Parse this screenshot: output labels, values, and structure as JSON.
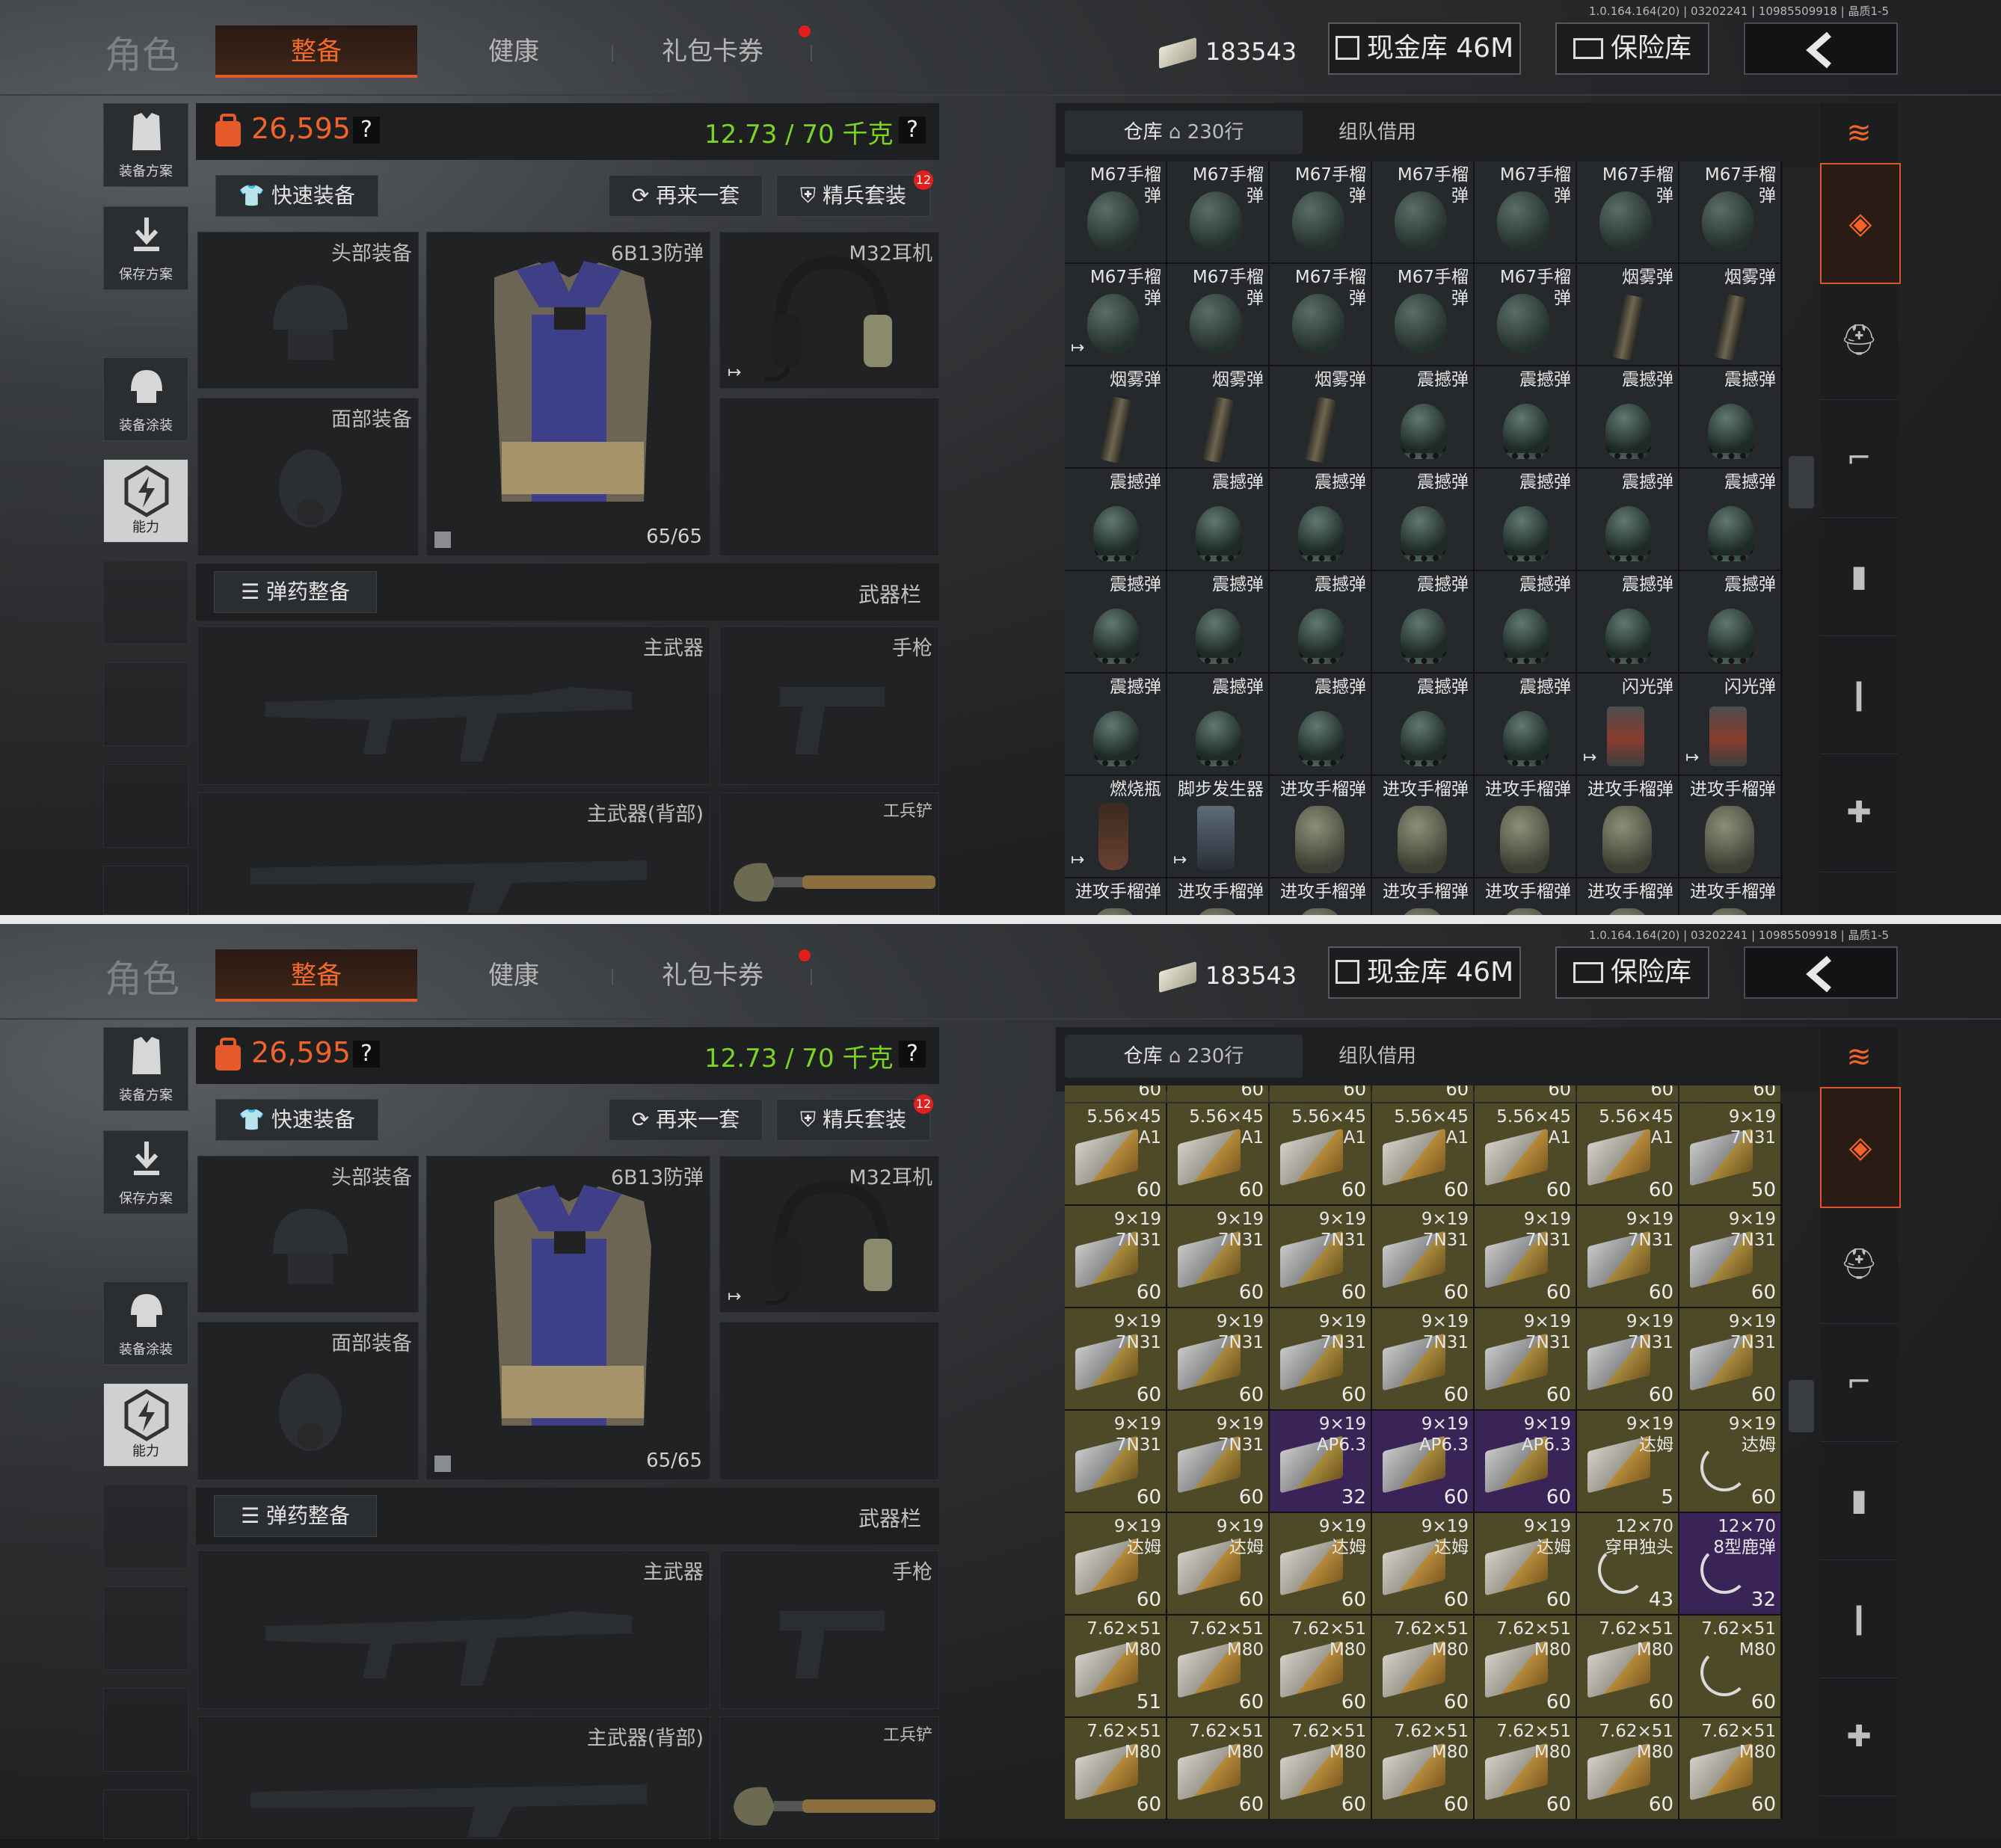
{
  "header": {
    "role_title": "角色",
    "tabs": [
      "整备",
      "健康",
      "礼包卡券"
    ],
    "active_tab": 0,
    "currency_amount": "183543",
    "cash_vault_label": "现金库 46M",
    "safe_label": "保险库",
    "version_text": "1.0.164.164(20) | 03202241 | 10985509918 | 晶质1-5"
  },
  "sidebar": {
    "items": [
      "装备方案",
      "保存方案",
      "装备涂装",
      "能力"
    ]
  },
  "loadout": {
    "value": "26,595",
    "weight": "12.73 / 70 千克",
    "help_icon": "?",
    "quick_equip_label": "快速装备",
    "again_label": "再来一套",
    "elite_label": "精兵套装",
    "elite_badge": "12",
    "head_slot_label": "头部装备",
    "face_slot_label": "面部装备",
    "armor_slot_label": "6B13防弹",
    "armor_durability": "65/65",
    "headset_slot_label": "M32耳机",
    "ammo_setup_label": "弹药整备",
    "weapon_bar_label": "武器栏",
    "primary_label": "主武器",
    "pistol_label": "手枪",
    "primary_back_label": "主武器(背部)",
    "shovel_label": "工兵铲"
  },
  "storage": {
    "tab_warehouse": "仓库",
    "warehouse_rows": "230行",
    "tab_team_borrow": "组队借用"
  },
  "screen1_items": [
    {
      "name": "M67手榴\n弹",
      "icon": "grenade"
    },
    {
      "name": "M67手榴\n弹",
      "icon": "grenade"
    },
    {
      "name": "M67手榴\n弹",
      "icon": "grenade"
    },
    {
      "name": "M67手榴\n弹",
      "icon": "grenade"
    },
    {
      "name": "M67手榴\n弹",
      "icon": "grenade"
    },
    {
      "name": "M67手榴\n弹",
      "icon": "grenade"
    },
    {
      "name": "M67手榴\n弹",
      "icon": "grenade"
    },
    {
      "name": "M67手榴\n弹",
      "icon": "grenade",
      "arrow": true
    },
    {
      "name": "M67手榴\n弹",
      "icon": "grenade"
    },
    {
      "name": "M67手榴\n弹",
      "icon": "grenade"
    },
    {
      "name": "M67手榴\n弹",
      "icon": "grenade"
    },
    {
      "name": "M67手榴\n弹",
      "icon": "grenade"
    },
    {
      "name": "烟雾弹",
      "icon": "smoke"
    },
    {
      "name": "烟雾弹",
      "icon": "smoke"
    },
    {
      "name": "烟雾弹",
      "icon": "smoke"
    },
    {
      "name": "烟雾弹",
      "icon": "smoke"
    },
    {
      "name": "烟雾弹",
      "icon": "smoke"
    },
    {
      "name": "震撼弹",
      "icon": "stun"
    },
    {
      "name": "震撼弹",
      "icon": "stun"
    },
    {
      "name": "震撼弹",
      "icon": "stun"
    },
    {
      "name": "震撼弹",
      "icon": "stun"
    },
    {
      "name": "震撼弹",
      "icon": "stun"
    },
    {
      "name": "震撼弹",
      "icon": "stun"
    },
    {
      "name": "震撼弹",
      "icon": "stun"
    },
    {
      "name": "震撼弹",
      "icon": "stun"
    },
    {
      "name": "震撼弹",
      "icon": "stun"
    },
    {
      "name": "震撼弹",
      "icon": "stun"
    },
    {
      "name": "震撼弹",
      "icon": "stun"
    },
    {
      "name": "震撼弹",
      "icon": "stun"
    },
    {
      "name": "震撼弹",
      "icon": "stun"
    },
    {
      "name": "震撼弹",
      "icon": "stun"
    },
    {
      "name": "震撼弹",
      "icon": "stun"
    },
    {
      "name": "震撼弹",
      "icon": "stun"
    },
    {
      "name": "震撼弹",
      "icon": "stun"
    },
    {
      "name": "震撼弹",
      "icon": "stun"
    },
    {
      "name": "震撼弹",
      "icon": "stun"
    },
    {
      "name": "震撼弹",
      "icon": "stun"
    },
    {
      "name": "震撼弹",
      "icon": "stun"
    },
    {
      "name": "震撼弹",
      "icon": "stun"
    },
    {
      "name": "震撼弹",
      "icon": "stun"
    },
    {
      "name": "闪光弹",
      "icon": "flash",
      "arrow": true
    },
    {
      "name": "闪光弹",
      "icon": "flash",
      "arrow": true
    },
    {
      "name": "燃烧瓶",
      "icon": "molotov",
      "arrow": true
    },
    {
      "name": "脚步发生器",
      "icon": "foot",
      "arrow": true
    },
    {
      "name": "进攻手榴弹",
      "icon": "ofg"
    },
    {
      "name": "进攻手榴弹",
      "icon": "ofg"
    },
    {
      "name": "进攻手榴弹",
      "icon": "ofg"
    },
    {
      "name": "进攻手榴弹",
      "icon": "ofg"
    },
    {
      "name": "进攻手榴弹",
      "icon": "ofg"
    },
    {
      "name": "进攻手榴弹",
      "icon": "ofg"
    },
    {
      "name": "进攻手榴弹",
      "icon": "ofg"
    },
    {
      "name": "进攻手榴弹",
      "icon": "ofg"
    },
    {
      "name": "进攻手榴弹",
      "icon": "ofg"
    },
    {
      "name": "进攻手榴弹",
      "icon": "ofg"
    },
    {
      "name": "进攻手榴弹",
      "icon": "ofg"
    },
    {
      "name": "进攻手榴弹",
      "icon": "ofg"
    }
  ],
  "screen2_items": [
    {
      "name": "5.56×45\nA1",
      "count": "60",
      "icon": "ammo",
      "tier": "ammo"
    },
    {
      "name": "5.56×45\nA1",
      "count": "60",
      "icon": "ammo",
      "tier": "ammo"
    },
    {
      "name": "5.56×45\nA1",
      "count": "60",
      "icon": "ammo",
      "tier": "ammo"
    },
    {
      "name": "5.56×45\nA1",
      "count": "60",
      "icon": "ammo",
      "tier": "ammo"
    },
    {
      "name": "5.56×45\nA1",
      "count": "60",
      "icon": "ammo",
      "tier": "ammo"
    },
    {
      "name": "5.56×45\nA1",
      "count": "60",
      "icon": "ammo",
      "tier": "ammo"
    },
    {
      "name": "9×19\n7N31",
      "count": "50",
      "icon": "ammo-dark",
      "tier": "ammo"
    },
    {
      "name": "9×19\n7N31",
      "count": "60",
      "icon": "ammo-dark",
      "tier": "ammo"
    },
    {
      "name": "9×19\n7N31",
      "count": "60",
      "icon": "ammo-dark",
      "tier": "ammo"
    },
    {
      "name": "9×19\n7N31",
      "count": "60",
      "icon": "ammo-dark",
      "tier": "ammo"
    },
    {
      "name": "9×19\n7N31",
      "count": "60",
      "icon": "ammo-dark",
      "tier": "ammo"
    },
    {
      "name": "9×19\n7N31",
      "count": "60",
      "icon": "ammo-dark",
      "tier": "ammo"
    },
    {
      "name": "9×19\n7N31",
      "count": "60",
      "icon": "ammo-dark",
      "tier": "ammo"
    },
    {
      "name": "9×19\n7N31",
      "count": "60",
      "icon": "ammo-dark",
      "tier": "ammo"
    },
    {
      "name": "9×19\n7N31",
      "count": "60",
      "icon": "ammo-dark",
      "tier": "ammo"
    },
    {
      "name": "9×19\n7N31",
      "count": "60",
      "icon": "ammo-dark",
      "tier": "ammo"
    },
    {
      "name": "9×19\n7N31",
      "count": "60",
      "icon": "ammo-dark",
      "tier": "ammo"
    },
    {
      "name": "9×19\n7N31",
      "count": "60",
      "icon": "ammo-dark",
      "tier": "ammo"
    },
    {
      "name": "9×19\n7N31",
      "count": "60",
      "icon": "ammo-dark",
      "tier": "ammo"
    },
    {
      "name": "9×19\n7N31",
      "count": "60",
      "icon": "ammo-dark",
      "tier": "ammo"
    },
    {
      "name": "9×19\n7N31",
      "count": "60",
      "icon": "ammo-dark",
      "tier": "ammo"
    },
    {
      "name": "9×19\n7N31",
      "count": "60",
      "icon": "ammo-dark",
      "tier": "ammo"
    },
    {
      "name": "9×19\n7N31",
      "count": "60",
      "icon": "ammo-dark",
      "tier": "ammo"
    },
    {
      "name": "9×19\nAP6.3",
      "count": "32",
      "icon": "ammo-dark",
      "tier": "rare"
    },
    {
      "name": "9×19\nAP6.3",
      "count": "60",
      "icon": "ammo-dark",
      "tier": "rare"
    },
    {
      "name": "9×19\nAP6.3",
      "count": "60",
      "icon": "ammo-dark",
      "tier": "rare"
    },
    {
      "name": "9×19\n达姆",
      "count": "5",
      "icon": "ammo",
      "tier": "ammo"
    },
    {
      "name": "9×19\n达姆",
      "count": "60",
      "icon": "ring",
      "tier": "ammo"
    },
    {
      "name": "9×19\n达姆",
      "count": "60",
      "icon": "ammo",
      "tier": "ammo"
    },
    {
      "name": "9×19\n达姆",
      "count": "60",
      "icon": "ammo",
      "tier": "ammo"
    },
    {
      "name": "9×19\n达姆",
      "count": "60",
      "icon": "ammo",
      "tier": "ammo"
    },
    {
      "name": "9×19\n达姆",
      "count": "60",
      "icon": "ammo",
      "tier": "ammo"
    },
    {
      "name": "9×19\n达姆",
      "count": "60",
      "icon": "ammo",
      "tier": "ammo"
    },
    {
      "name": "12×70\n穿甲独头",
      "count": "43",
      "icon": "ring",
      "tier": "ammo"
    },
    {
      "name": "12×70\n8型鹿弹",
      "count": "32",
      "icon": "ring",
      "tier": "rare"
    },
    {
      "name": "7.62×51\nM80",
      "count": "51",
      "icon": "ammo",
      "tier": "ammo"
    },
    {
      "name": "7.62×51\nM80",
      "count": "60",
      "icon": "ammo",
      "tier": "ammo"
    },
    {
      "name": "7.62×51\nM80",
      "count": "60",
      "icon": "ammo",
      "tier": "ammo"
    },
    {
      "name": "7.62×51\nM80",
      "count": "60",
      "icon": "ammo",
      "tier": "ammo"
    },
    {
      "name": "7.62×51\nM80",
      "count": "60",
      "icon": "ammo",
      "tier": "ammo"
    },
    {
      "name": "7.62×51\nM80",
      "count": "60",
      "icon": "ammo",
      "tier": "ammo"
    },
    {
      "name": "7.62×51\nM80",
      "count": "60",
      "icon": "ring",
      "tier": "ammo"
    },
    {
      "name": "7.62×51\nM80",
      "count": "60",
      "icon": "ammo",
      "tier": "ammo"
    },
    {
      "name": "7.62×51\nM80",
      "count": "60",
      "icon": "ammo",
      "tier": "ammo"
    },
    {
      "name": "7.62×51\nM80",
      "count": "60",
      "icon": "ammo",
      "tier": "ammo"
    },
    {
      "name": "7.62×51\nM80",
      "count": "60",
      "icon": "ammo",
      "tier": "ammo"
    },
    {
      "name": "7.62×51\nM80",
      "count": "60",
      "icon": "ammo",
      "tier": "ammo"
    },
    {
      "name": "7.62×51\nM80",
      "count": "60",
      "icon": "ammo",
      "tier": "ammo"
    },
    {
      "name": "7.62×51\nM80",
      "count": "60",
      "icon": "ammo",
      "tier": "ammo"
    }
  ],
  "screen2_partial_count": "60",
  "colors": {
    "accent": "#f06a2c",
    "value": "#f0642a",
    "weight": "#7ed321",
    "rare": "#3a2457",
    "ammo": "#4e4a28"
  }
}
